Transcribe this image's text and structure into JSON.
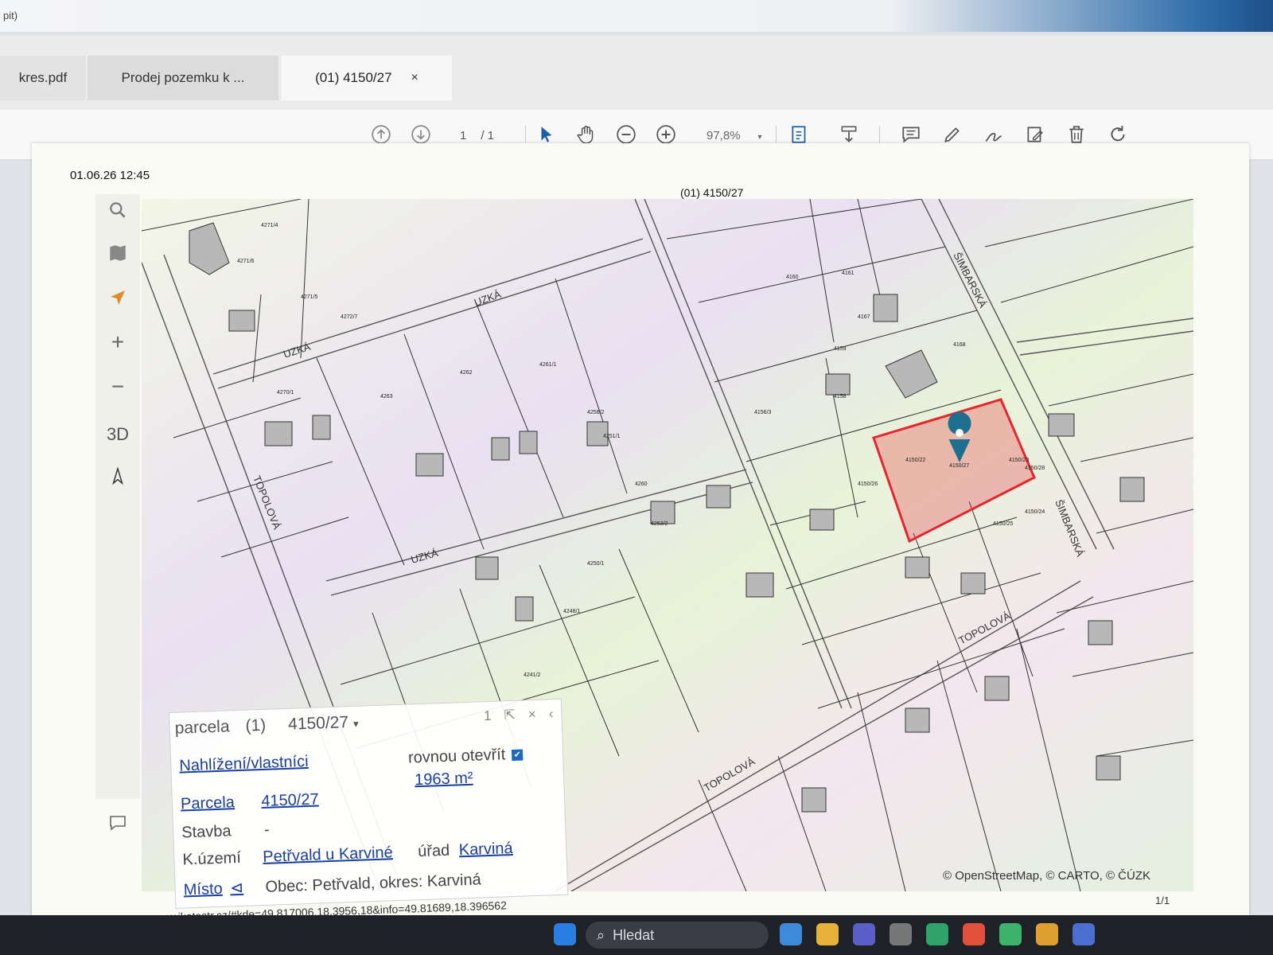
{
  "window": {
    "title_fragment": "pit)"
  },
  "tabs": [
    {
      "label": "kres.pdf"
    },
    {
      "label": "Prodej pozemku k ..."
    },
    {
      "label": "(01) 4150/27",
      "close": "×"
    }
  ],
  "toolbar": {
    "page_current": "1",
    "page_total": "/ 1",
    "zoom": "97,8%",
    "zoom_caret": "▾",
    "icons": [
      "page-up-icon",
      "page-down-icon",
      "select-arrow-icon",
      "hand-pan-icon",
      "zoom-out-icon",
      "zoom-in-icon",
      "fit-page-icon",
      "download-icon",
      "comment-icon",
      "highlight-pen-icon",
      "sign-icon",
      "edit-pdf-icon",
      "delete-icon",
      "rotate-icon"
    ]
  },
  "document": {
    "timestamp": "01.06.26 12:45",
    "page_title": "(01) 4150/27",
    "credit": "© OpenStreetMap, © CARTO, © ČÚZK",
    "page_counter": "1/1",
    "url": "www.ikatastr.cz/#kde=49.817006,18.3956,18&info=49.81689,18.396562"
  },
  "map": {
    "controls": {
      "zoom_in": "+",
      "zoom_out": "−",
      "view_3d": "3D"
    },
    "streets": [
      "UZKÁ",
      "UZKÁ",
      "UZKÁ",
      "TOPOLOVÁ",
      "TOPOLOVÁ",
      "TOPOLOVÁ",
      "ŠIMBARSKÁ",
      "ŠIMBARSKÁ"
    ],
    "highlight_color": "#e8242f",
    "parcel_labels": [
      "4271/4",
      "4271/6",
      "4271/5",
      "4272/7",
      "4270/1",
      "4263",
      "4262",
      "4261/1",
      "4256/2",
      "4251/1",
      "4260",
      "4253/2",
      "4250/1",
      "4248/1",
      "4241/2",
      "4150/22",
      "4150/23",
      "4150/24",
      "4150/25",
      "4150/26",
      "4150/27",
      "4150/28",
      "4156/3",
      "4158",
      "4159",
      "4160",
      "4161",
      "4167",
      "4168"
    ]
  },
  "popup": {
    "type_label": "parcela",
    "number_label": "(1)",
    "parcel_id": "4150/27",
    "caret": "▾",
    "count": "1",
    "share_icon": "⇱",
    "close_icon": "×",
    "collapse_icon": "‹",
    "view_owner_link": "Nahlížení/vlastníci",
    "open_directly_label": "rovnou otevřít",
    "open_directly_checked": "✔",
    "area": "1963 m²",
    "parcel_label": "Parcela",
    "parcel_value": "4150/27",
    "building_label": "Stavba",
    "building_value": "-",
    "cadastral_label": "K.území",
    "cadastral_value": "Petřvald u Karviné",
    "office_label": "úřad",
    "office_value": "Karviná",
    "place_link": "Místo",
    "place_icon": "⊲",
    "place_value": "Obec: Petřvald, okres: Karviná"
  },
  "taskbar": {
    "search_placeholder": "Hledat",
    "search_icon": "⌕"
  }
}
